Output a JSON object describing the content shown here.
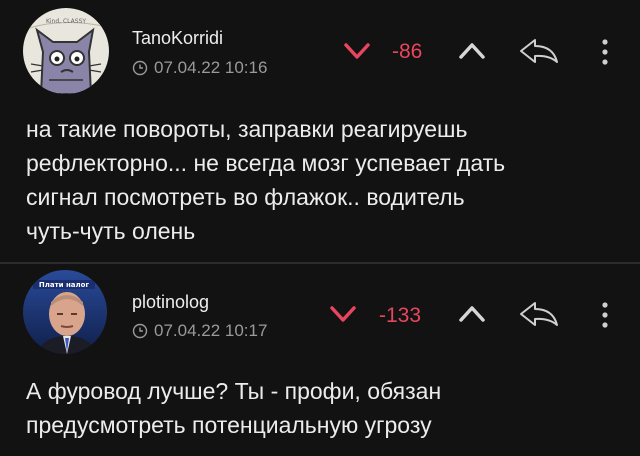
{
  "comments": [
    {
      "username": "TanoKorridi",
      "timestamp": "07.04.22 10:16",
      "score": "-86",
      "body_lines": [
        "на такие повороты, заправки реагируешь",
        "рефлекторно... не всегда мозг успевает дать",
        "сигнал посмотреть во флажок.. водитель",
        "чуть-чуть олень"
      ],
      "avatar_icon": "cartoon-cat-avatar",
      "avatar_text": "Kind, CLASSY"
    },
    {
      "username": "plotinolog",
      "timestamp": "07.04.22 10:17",
      "score": "-133",
      "body_lines": [
        "А фуровод лучше? Ты - профи, обязан",
        "предусмотреть потенциальную угрозу"
      ],
      "avatar_icon": "photo-avatar",
      "avatar_text": "Плати налог"
    }
  ],
  "icons": {
    "timestamp": "clock-icon",
    "downvote": "chevron-down-icon",
    "upvote": "chevron-up-icon",
    "reply": "reply-arrow-icon",
    "more": "more-vertical-icon"
  },
  "colors": {
    "background": "#121212",
    "score_negative": "#e8455e",
    "text": "#ececec",
    "meta": "#9a9a9a",
    "icon": "#cfcfcf"
  }
}
